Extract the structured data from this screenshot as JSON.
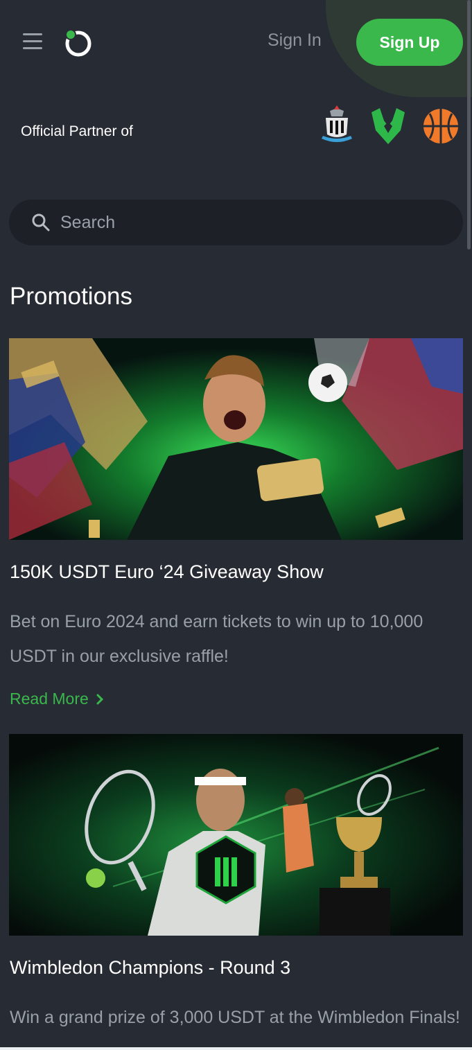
{
  "header": {
    "sign_in": "Sign In",
    "sign_up": "Sign Up",
    "brand_color": "#3ab84c"
  },
  "partners": {
    "label": "Official Partner of",
    "logos": [
      "newcastle-crest-icon",
      "esports-team-icon",
      "basketball-icon"
    ]
  },
  "search": {
    "placeholder": "Search"
  },
  "promotions": {
    "title": "Promotions",
    "items": [
      {
        "title": "150K USDT Euro ‘24 Giveaway Show",
        "description": "Bet on Euro 2024 and earn tickets to win up to 10,000 USDT in our exclusive raffle!",
        "link": "Read More"
      },
      {
        "title": "Wimbledon Champions - Round 3",
        "description": "Win a grand prize of 3,000 USDT at the Wimbledon Finals!"
      }
    ]
  }
}
